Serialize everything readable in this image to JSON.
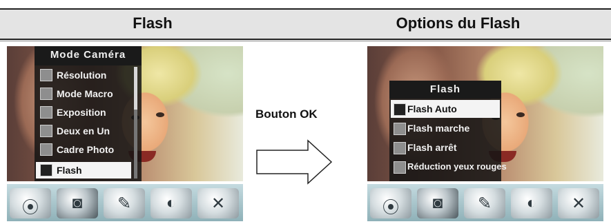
{
  "header": {
    "left_title": "Flash",
    "right_title": "Options du Flash"
  },
  "left_screen": {
    "menu_title": "Mode Caméra",
    "items": [
      {
        "label": "Résolution",
        "icon": "resolution-icon",
        "selected": false
      },
      {
        "label": "Mode Macro",
        "icon": "macro-icon",
        "selected": false
      },
      {
        "label": "Exposition",
        "icon": "exposure-icon",
        "selected": false
      },
      {
        "label": "Deux en Un",
        "icon": "two-in-one-icon",
        "selected": false
      },
      {
        "label": "Cadre Photo",
        "icon": "photo-frame-icon",
        "selected": false
      },
      {
        "label": "Flash",
        "icon": "flash-icon",
        "selected": true
      }
    ],
    "iconbar": [
      "video-reel-icon",
      "camera-icon",
      "microphone-icon",
      "palette-icon",
      "tools-icon"
    ],
    "active_icon_index": 1
  },
  "arrow": {
    "label": "Bouton OK"
  },
  "right_screen": {
    "menu_title": "Flash",
    "items": [
      {
        "label": "Flash Auto",
        "icon": "flash-auto-icon",
        "selected": true
      },
      {
        "label": "Flash marche",
        "icon": "flash-on-icon",
        "selected": false
      },
      {
        "label": "Flash arrêt",
        "icon": "flash-off-icon",
        "selected": false
      },
      {
        "label": "Réduction yeux rouges",
        "icon": "red-eye-icon",
        "selected": false
      }
    ],
    "iconbar": [
      "video-reel-icon",
      "camera-icon",
      "microphone-icon",
      "palette-icon",
      "tools-icon"
    ],
    "active_icon_index": 1
  }
}
